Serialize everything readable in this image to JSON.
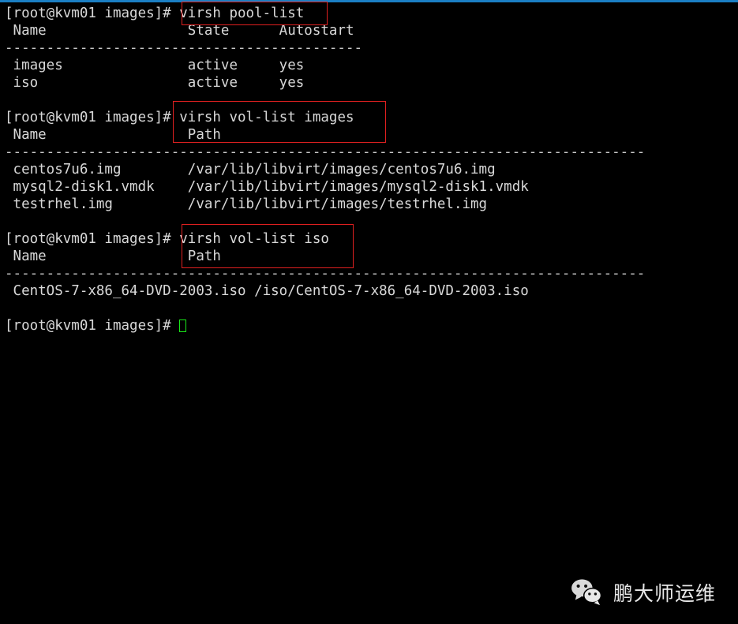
{
  "window": {
    "accent_bar_color": "#1b7fc4",
    "background_color": "#000000",
    "foreground_color": "#d8d8d8",
    "annotation_color": "#e02020",
    "cursor_color": "#19e619"
  },
  "terminal": {
    "prompt": "[root@kvm01 images]#",
    "blocks": [
      {
        "name": "pool-list",
        "command": "virsh pool-list",
        "header": " Name                 State      Autostart",
        "separator": "-------------------------------------------",
        "rows": [
          " images               active     yes",
          " iso                  active     yes"
        ]
      },
      {
        "name": "vol-list-images",
        "command": "virsh vol-list images",
        "header": " Name                 Path",
        "separator": "-----------------------------------------------------------------------------",
        "rows": [
          " centos7u6.img        /var/lib/libvirt/images/centos7u6.img",
          " mysql2-disk1.vmdk    /var/lib/libvirt/images/mysql2-disk1.vmdk",
          " testrhel.img         /var/lib/libvirt/images/testrhel.img"
        ]
      },
      {
        "name": "vol-list-iso",
        "command": "virsh vol-list iso",
        "header": " Name                 Path",
        "separator": "-----------------------------------------------------------------------------",
        "rows": [
          " CentOS-7-x86_64-DVD-2003.iso /iso/CentOS-7-x86_64-DVD-2003.iso"
        ]
      }
    ],
    "final_prompt": "[root@kvm01 images]# "
  },
  "annotations": [
    {
      "name": "virsh-pool-list-highlight",
      "target": "virsh pool-list"
    },
    {
      "name": "virsh-vol-list-images-highlight",
      "target": "virsh vol-list images"
    },
    {
      "name": "virsh-vol-list-iso-highlight",
      "target": "virsh vol-list iso"
    }
  ],
  "watermark": {
    "icon": "wechat-icon",
    "text": "鹏大师运维"
  }
}
